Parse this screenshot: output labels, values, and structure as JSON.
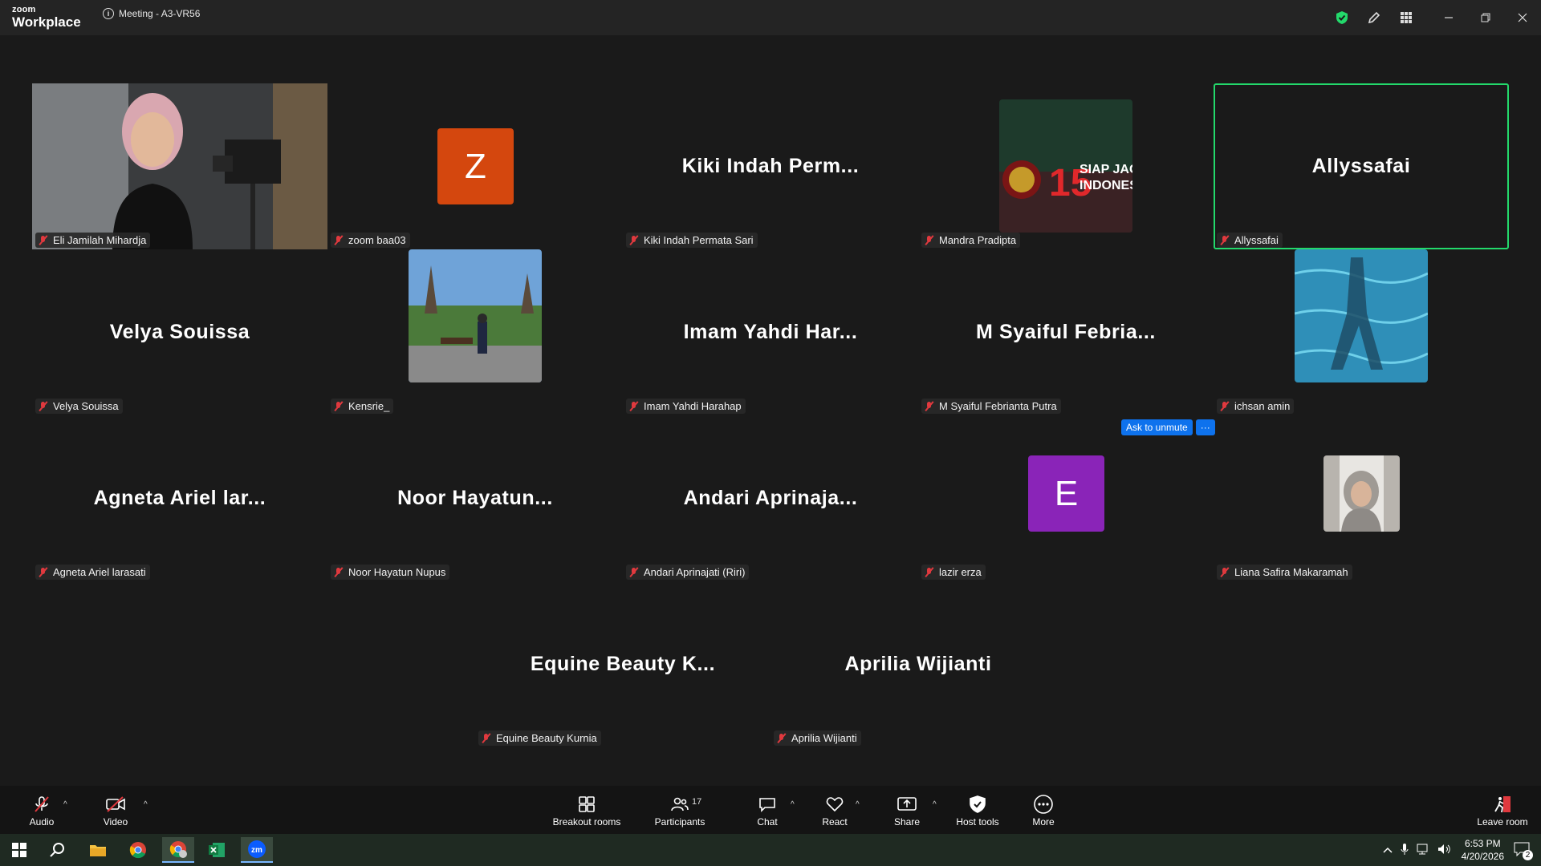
{
  "app": {
    "brand_small": "zoom",
    "brand_big": "Workplace",
    "meeting_title": "Meeting - A3-VR56"
  },
  "tiles": [
    {
      "name": "Eli Jamilah Mihardja",
      "display": "",
      "type": "video"
    },
    {
      "name": "zoom baa03",
      "display": "Z",
      "type": "avatar",
      "color": "#d4470e"
    },
    {
      "name": "Kiki Indah Permata Sari",
      "display": "Kiki Indah Perm...",
      "type": "name"
    },
    {
      "name": "Mandra Pradipta",
      "display": "",
      "type": "photo"
    },
    {
      "name": "Allyssafai",
      "display": "Allyssafai",
      "type": "name",
      "active": true
    },
    {
      "name": "Velya Souissa",
      "display": "Velya Souissa",
      "type": "name"
    },
    {
      "name": "Kensrie_",
      "display": "",
      "type": "photo"
    },
    {
      "name": "Imam Yahdi Harahap",
      "display": "Imam Yahdi Har...",
      "type": "name"
    },
    {
      "name": "M Syaiful Febrianta Putra",
      "display": "M Syaiful Febria...",
      "type": "name"
    },
    {
      "name": "ichsan amin",
      "display": "",
      "type": "photo"
    },
    {
      "name": "Agneta Ariel larasati",
      "display": "Agneta Ariel lar...",
      "type": "name"
    },
    {
      "name": "Noor Hayatun Nupus",
      "display": "Noor Hayatun...",
      "type": "name"
    },
    {
      "name": "Andari Aprinajati (Riri)",
      "display": "Andari Aprinaja...",
      "type": "name"
    },
    {
      "name": "lazir erza",
      "display": "E",
      "type": "avatar",
      "color": "#8a24b8"
    },
    {
      "name": "Liana Safira Makaramah",
      "display": "",
      "type": "photo"
    },
    {
      "name": "Equine Beauty Kurnia",
      "display": "Equine Beauty K...",
      "type": "name"
    },
    {
      "name": "Aprilia Wijianti",
      "display": "Aprilia Wijianti",
      "type": "name"
    }
  ],
  "ask_unmute": {
    "label": "Ask to unmute",
    "more": "···"
  },
  "toolbar": {
    "audio": "Audio",
    "video": "Video",
    "breakout": "Breakout rooms",
    "participants": "Participants",
    "participants_count": "17",
    "chat": "Chat",
    "react": "React",
    "share": "Share",
    "host_tools": "Host tools",
    "more": "More",
    "leave": "Leave room"
  },
  "taskbar": {
    "time": "6:53 PM",
    "date": "4/20/2026",
    "notifications": "2"
  },
  "colors": {
    "accent": "#23d96b",
    "brand_blue": "#0e72ed",
    "mute_red": "#e0393e"
  }
}
